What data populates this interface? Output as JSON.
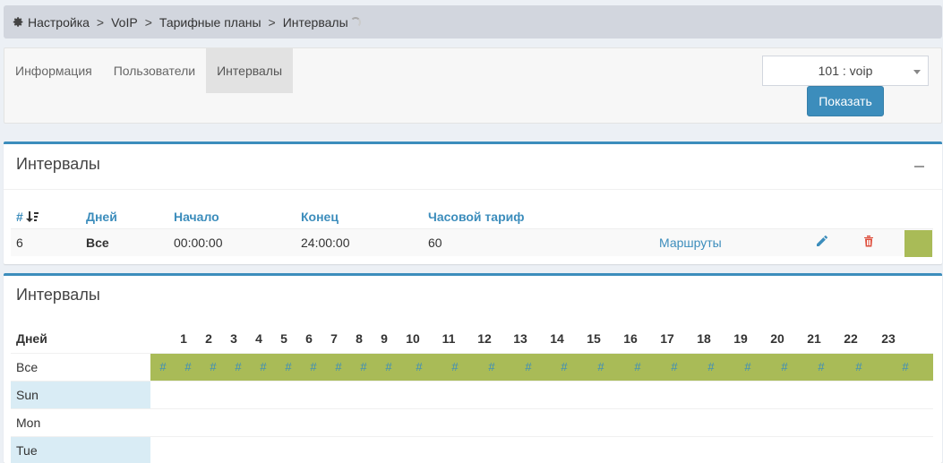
{
  "breadcrumb": {
    "items": [
      "Настройка",
      "VoIP",
      "Тарифные планы",
      "Интервалы"
    ],
    "separator": ">"
  },
  "tabs": [
    {
      "label": "Информация",
      "active": false
    },
    {
      "label": "Пользователи",
      "active": false
    },
    {
      "label": "Интервалы",
      "active": true
    }
  ],
  "plan_select": {
    "value": "101 : voip"
  },
  "show_button": {
    "label": "Показать"
  },
  "intervals_box": {
    "title": "Интервалы",
    "columns": [
      "#",
      "Дней",
      "Начало",
      "Конец",
      "Часовой тариф"
    ],
    "row": {
      "id": "6",
      "days": "Все",
      "start": "00:00:00",
      "end": "24:00:00",
      "rate": "60",
      "routes_link": "Маршруты",
      "color": "#a9bb57"
    }
  },
  "schedule_box": {
    "title": "Интервалы",
    "days_header": "Дней",
    "hours": [
      "1",
      "2",
      "3",
      "4",
      "5",
      "6",
      "7",
      "8",
      "9",
      "10",
      "11",
      "12",
      "13",
      "14",
      "15",
      "16",
      "17",
      "18",
      "19",
      "20",
      "21",
      "22",
      "23"
    ],
    "hash_mark": "#",
    "hash_count": 24,
    "rows": [
      {
        "label": "Все",
        "filled": true
      },
      {
        "label": "Sun",
        "filled": false
      },
      {
        "label": "Mon",
        "filled": false
      },
      {
        "label": "Tue",
        "filled": false
      }
    ]
  },
  "colors": {
    "accent": "#3c8dbc",
    "interval_fill": "#a9bb57",
    "delete": "#dd4b39"
  }
}
